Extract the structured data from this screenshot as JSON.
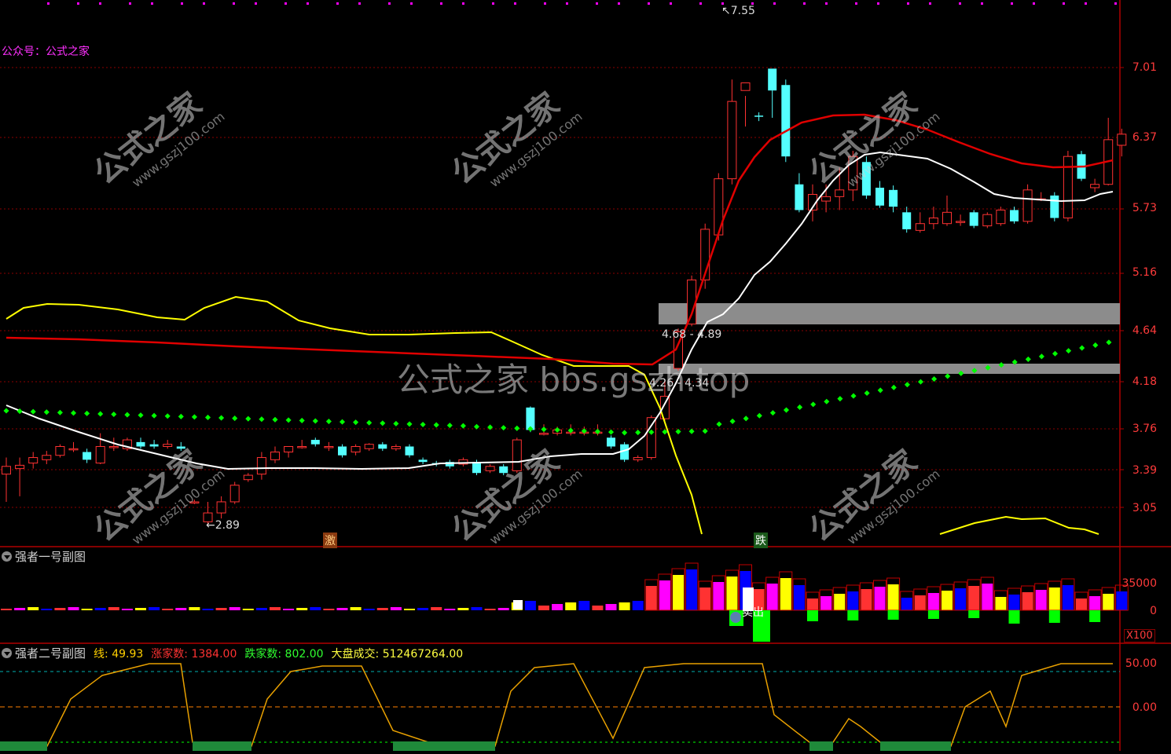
{
  "header": {
    "public_account": "公众号：公式之家"
  },
  "main": {
    "price_axis": [
      "7.01",
      "6.37",
      "5.73",
      "5.16",
      "4.64",
      "4.18",
      "3.76",
      "3.39",
      "3.05"
    ],
    "high_label": "7.55",
    "low_label": "2.89",
    "zone_upper_label": "4.68 - 4.89",
    "zone_lower_label": "4.26 - 4.34",
    "signal_up": "激",
    "signal_down": "跌",
    "watermark_center": "公式之家 bbs.gszh.top",
    "watermark_text": "公式之家",
    "watermark_url": "www.gszj100.com"
  },
  "sub1": {
    "title": "强者一号副图",
    "axis": [
      "35000",
      "0"
    ],
    "multiplier": "X100",
    "sell_label": "卖出"
  },
  "sub2": {
    "title": "强者二号副图",
    "line_label": "线:",
    "line_value": "49.93",
    "rise_label": "涨家数:",
    "rise_value": "1384.00",
    "fall_label": "跌家数:",
    "fall_value": "802.00",
    "market_label": "大盘成交:",
    "market_value": "512467264.00",
    "axis": [
      "50.00",
      "0.00"
    ]
  },
  "colors": {
    "up": "#ff3232",
    "down": "#54ffff",
    "grid": "#8b0000",
    "yellow": "#ffff00",
    "white": "#ffffff",
    "green": "#00ff00",
    "magenta": "#ff00ff",
    "blue": "#0000ff",
    "orange": "#e8a000"
  }
}
